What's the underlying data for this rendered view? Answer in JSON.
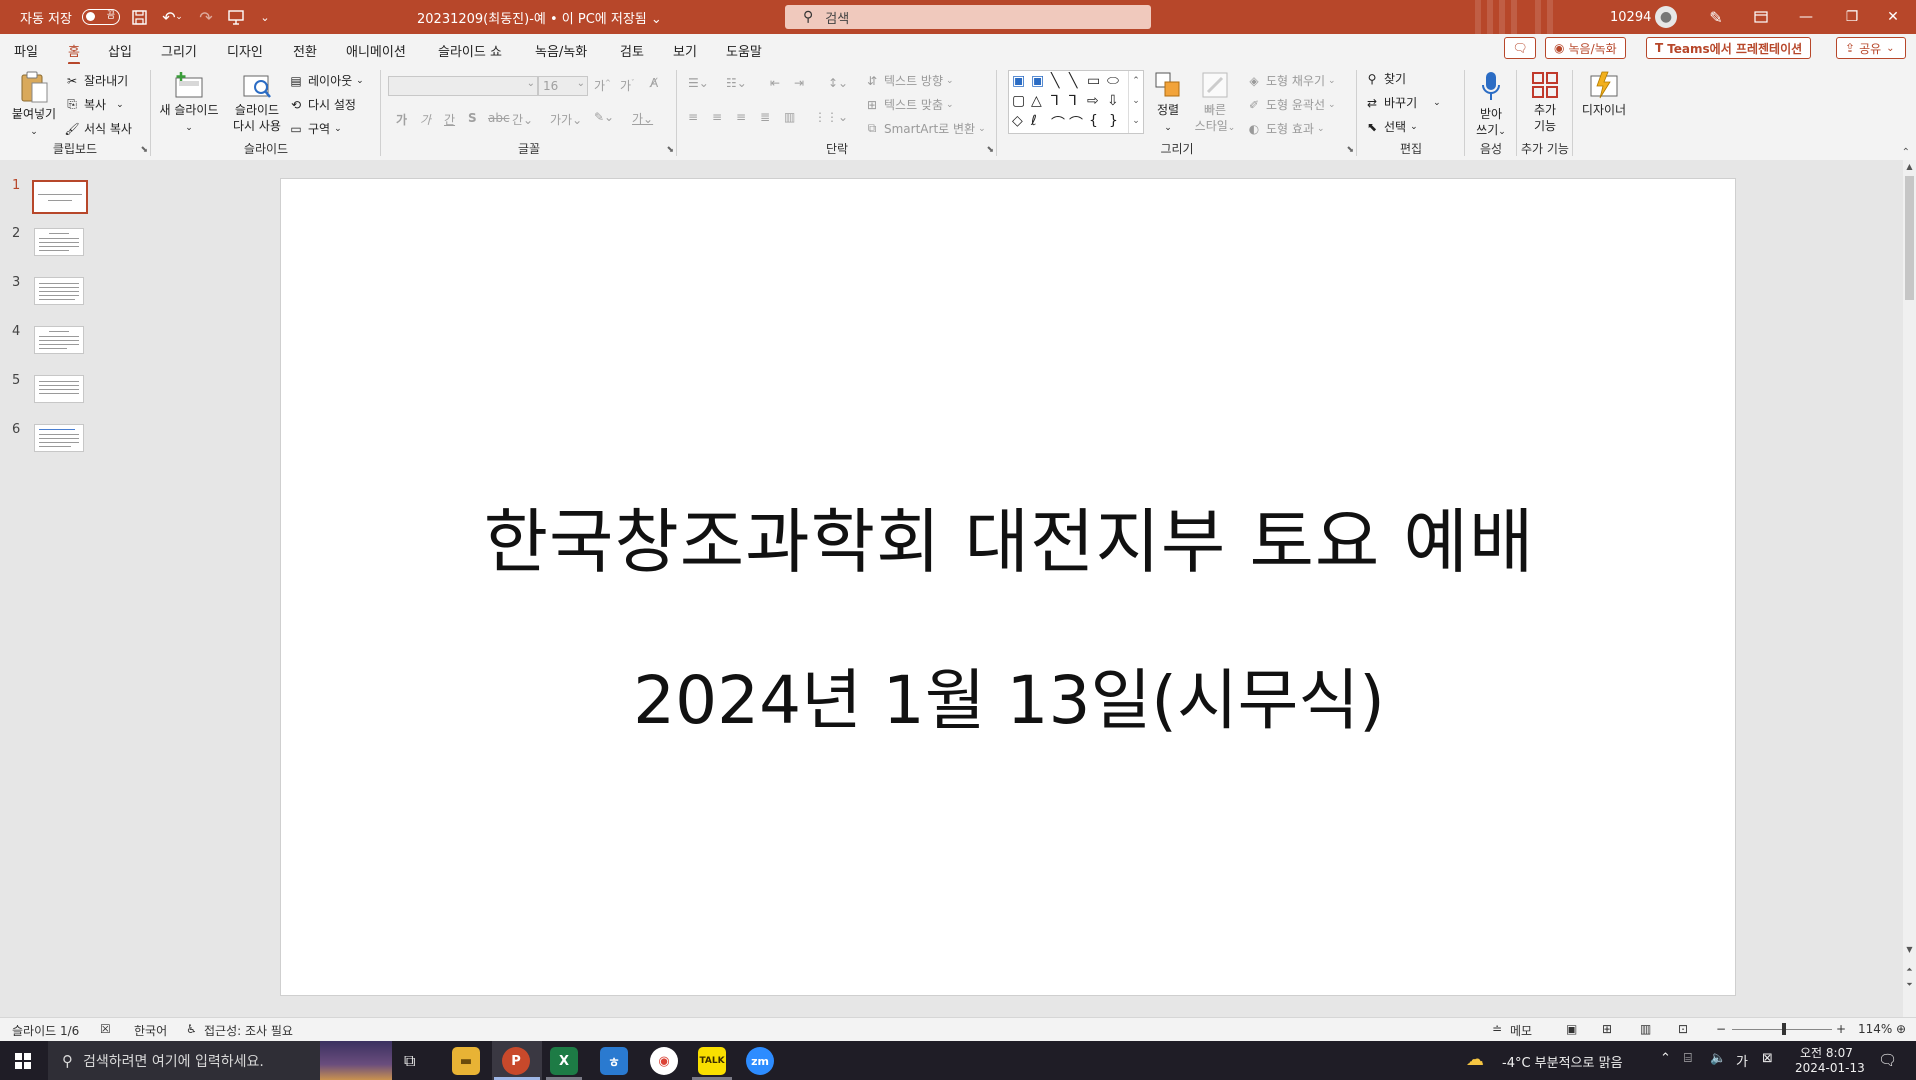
{
  "titlebar": {
    "autosave_label": "자동 저장",
    "autosave_toggle": "끔",
    "doc_title": "20231209(최동진)-예 • 이 PC에 저장됨 ⌄",
    "search_placeholder": "검색",
    "user_count": "10294"
  },
  "menu": {
    "tabs": [
      "파일",
      "홈",
      "삽입",
      "그리기",
      "디자인",
      "전환",
      "애니메이션",
      "슬라이드 쇼",
      "녹음/녹화",
      "검토",
      "보기",
      "도움말"
    ],
    "active_tab": "홈",
    "record_button": "녹음/녹화",
    "teams_button": "Teams에서 프레젠테이션",
    "share_button": "공유"
  },
  "ribbon": {
    "clipboard": {
      "label": "클립보드",
      "paste": "붙여넣기",
      "cut": "잘라내기",
      "copy": "복사",
      "format_painter": "서식 복사"
    },
    "slides": {
      "label": "슬라이드",
      "new_slide": "새 슬라이드",
      "reuse_1": "슬라이드",
      "reuse_2": "다시 사용",
      "layout": "레이아웃",
      "reset": "다시 설정",
      "section": "구역"
    },
    "font": {
      "label": "글꼴",
      "size": "16"
    },
    "paragraph": {
      "label": "단락",
      "text_direction": "텍스트 방향",
      "align_text": "텍스트 맞춤",
      "smartart": "SmartArt로 변환"
    },
    "drawing": {
      "label": "그리기",
      "arrange": "정렬",
      "quick_styles_1": "빠른",
      "quick_styles_2": "스타일",
      "fill": "도형 채우기",
      "outline": "도형 윤곽선",
      "effects": "도형 효과"
    },
    "editing": {
      "label": "편집",
      "find": "찾기",
      "replace": "바꾸기",
      "select": "선택"
    },
    "voice": {
      "label": "음성",
      "dictate_1": "받아",
      "dictate_2": "쓰기"
    },
    "addins": {
      "label": "추가 기능",
      "addins_1": "추가",
      "addins_2": "기능"
    },
    "designer": "디자이너"
  },
  "slides_pane": {
    "numbers": [
      "1",
      "2",
      "3",
      "4",
      "5",
      "6"
    ],
    "selected": "1"
  },
  "slide": {
    "title": "한국창조과학회 대전지부 토요 예배",
    "subtitle": "2024년 1월 13일(시무식)"
  },
  "statusbar": {
    "slide_counter": "슬라이드 1/6",
    "language": "한국어",
    "accessibility": "접근성: 조사 필요",
    "notes": "메모",
    "zoom": "114%"
  },
  "taskbar": {
    "search_placeholder": "검색하려면 여기에 입력하세요.",
    "weather": "-4°C  부분적으로 맑음",
    "ime": "가",
    "time": "오전 8:07",
    "date": "2024-01-13"
  },
  "colors": {
    "accent": "#b7472a",
    "taskbar": "#1f1d26"
  }
}
